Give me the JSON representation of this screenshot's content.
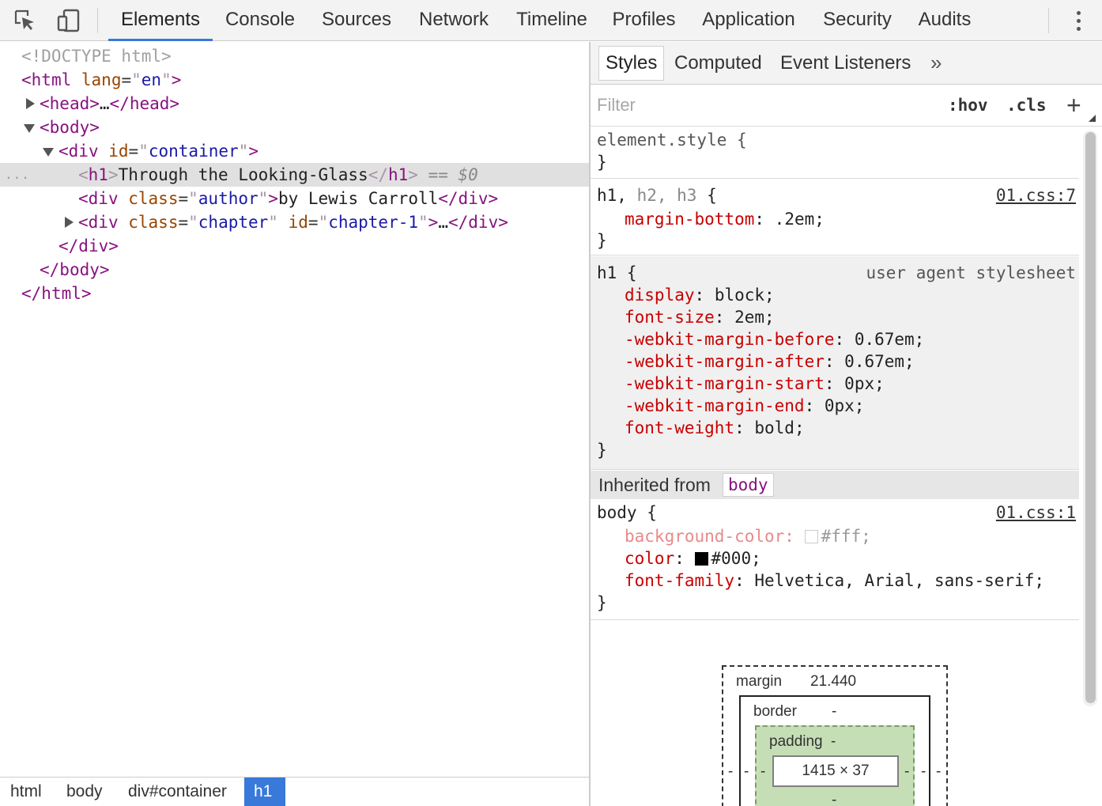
{
  "toolbar": {
    "tabs": [
      "Elements",
      "Console",
      "Sources",
      "Network",
      "Timeline",
      "Profiles",
      "Application",
      "Security",
      "Audits"
    ],
    "active_tab": "Elements",
    "icons": [
      "inspect-element-icon",
      "device-mode-icon",
      "more-options-icon"
    ]
  },
  "dom": {
    "doctype": "<!DOCTYPE html>",
    "html_tag": "html",
    "html_attr_name": "lang",
    "html_attr_value": "en",
    "head_tag": "head",
    "ellipsis": "…",
    "body_tag": "body",
    "div_tag": "div",
    "container_attr_name": "id",
    "container_attr_value": "container",
    "h1_tag": "h1",
    "h1_text": "Through the Looking-Glass",
    "selected_marker": "== $0",
    "author_attr_name": "class",
    "author_attr_value": "author",
    "author_text": "by Lewis Carroll",
    "chapter_class_name": "class",
    "chapter_class_value": "chapter",
    "chapter_id_name": "id",
    "chapter_id_value": "chapter-1",
    "row_dots": "..."
  },
  "breadcrumbs": [
    "html",
    "body",
    "div#container",
    "h1"
  ],
  "styles_panel": {
    "tabs": [
      "Styles",
      "Computed",
      "Event Listeners"
    ],
    "overflow_chevron": "»",
    "filter_placeholder": "Filter",
    "hov": ":hov",
    "cls": ".cls",
    "add": "+",
    "element_style": {
      "selector": "element.style {",
      "close": "}"
    },
    "rule1": {
      "selector_main": "h1,",
      "selector_dim": "h2, h3",
      "open": "{",
      "source": "01.css:7",
      "props": [
        {
          "name": "margin-bottom",
          "value": ".2em;"
        }
      ],
      "close": "}"
    },
    "rule_ua": {
      "selector": "h1 {",
      "source": "user agent stylesheet",
      "props": [
        {
          "name": "display",
          "value": "block;"
        },
        {
          "name": "font-size",
          "value": "2em;"
        },
        {
          "name": "-webkit-margin-before",
          "value": "0.67em;"
        },
        {
          "name": "-webkit-margin-after",
          "value": "0.67em;"
        },
        {
          "name": "-webkit-margin-start",
          "value": "0px;"
        },
        {
          "name": "-webkit-margin-end",
          "value": "0px;"
        },
        {
          "name": "font-weight",
          "value": "bold;"
        }
      ],
      "close": "}"
    },
    "inherited_label": "Inherited from",
    "inherited_from": "body",
    "rule_body": {
      "selector": "body {",
      "source": "01.css:1",
      "props": [
        {
          "name": "background-color",
          "value": "#fff;",
          "swatch": "#ffffff",
          "overridden": true
        },
        {
          "name": "color",
          "value": "#000;",
          "swatch": "#000000",
          "overridden": false
        },
        {
          "name": "font-family",
          "value": "Helvetica, Arial, sans-serif;"
        }
      ],
      "close": "}"
    }
  },
  "box_model": {
    "margin_label": "margin",
    "margin_top": "21.440",
    "border_label": "border",
    "border_top": "-",
    "padding_label": "padding",
    "padding_top": "-",
    "content": "1415 × 37",
    "dash": "-"
  },
  "colors": {
    "accent": "#3879d9",
    "tag": "#881280",
    "attr_name": "#994500",
    "attr_value": "#1a1aa6",
    "prop_name": "#c80000",
    "padding_box": "#c6deb6"
  }
}
